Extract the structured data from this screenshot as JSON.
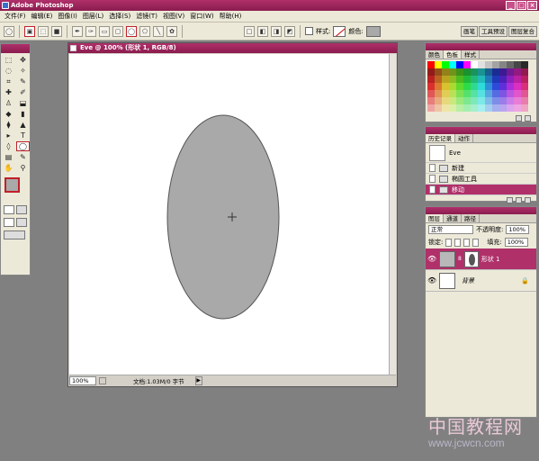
{
  "app": {
    "title": "Adobe Photoshop"
  },
  "window_buttons": [
    "_",
    "□",
    "×"
  ],
  "menu": [
    "文件(F)",
    "编辑(E)",
    "图像(I)",
    "图层(L)",
    "选择(S)",
    "滤镜(T)",
    "视图(V)",
    "窗口(W)",
    "帮助(H)"
  ],
  "options": {
    "style_label": "样式:",
    "color_label": "颜色:",
    "shape_color": "#a9a9a9",
    "palette_tabs": [
      "画笔",
      "工具预设",
      "图层复合"
    ]
  },
  "toolbox": {
    "tools": [
      "⬚",
      "✥",
      "◌",
      "✧",
      "⌗",
      "✎",
      "✚",
      "✐",
      "♙",
      "⬓",
      "◆",
      "▮",
      "⧫",
      "▲",
      "▸",
      "T",
      "◊",
      "◯",
      "▤",
      "✎",
      "✋",
      "⚲"
    ],
    "fg_color": "#a9a9a9",
    "bg_color": "#ffffff"
  },
  "document": {
    "title": "Eve @ 100% (形状 1, RGB/8)",
    "zoom": "100%",
    "info": "文档:1.03M/0 字节",
    "ellipse_fill": "#a9a9a9",
    "ellipse_stroke": "#555555"
  },
  "swatches_panel": {
    "tabs": [
      "颜色",
      "色板",
      "样式"
    ],
    "active_tab": "色板"
  },
  "history_panel": {
    "tabs": [
      "历史记录",
      "动作"
    ],
    "snapshot": "Eve",
    "items": [
      "新建",
      "椭圆工具",
      "移动"
    ],
    "selected": "移动"
  },
  "layers_panel": {
    "tabs": [
      "图层",
      "通道",
      "路径"
    ],
    "blend_mode": "正常",
    "opacity_label": "不透明度:",
    "opacity": "100%",
    "lock_label": "锁定:",
    "fill_label": "填充:",
    "fill": "100%",
    "layers": [
      {
        "name": "形状 1",
        "selected": true
      },
      {
        "name": "背景",
        "selected": false
      }
    ]
  },
  "watermark": {
    "line1": "中国教程网",
    "line2": "www.jcwcn.com"
  }
}
